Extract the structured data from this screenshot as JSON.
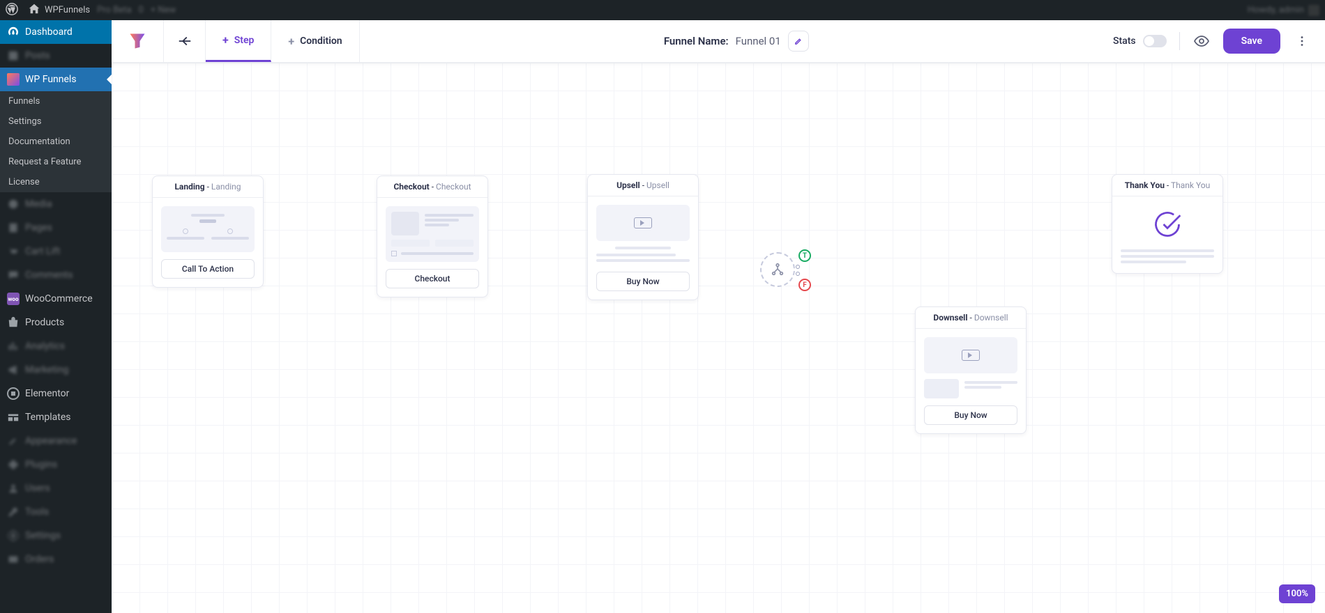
{
  "adminbar": {
    "site_name": "WPFunnels",
    "howdy": "Howdy, admin",
    "blur1": "Pro Beta",
    "blur2": "0",
    "blur3": "+ New"
  },
  "sidebar": {
    "dashboard": "Dashboard",
    "wp_funnels": "WP Funnels",
    "sub": {
      "funnels": "Funnels",
      "settings": "Settings",
      "documentation": "Documentation",
      "request": "Request a Feature",
      "license": "License"
    },
    "woocommerce": "WooCommerce",
    "products": "Products",
    "elementor": "Elementor",
    "templates": "Templates",
    "b": {
      "posts": "Posts",
      "media": "Media",
      "pages": "Pages",
      "cartlift": "Cart Lift",
      "comments": "Comments",
      "analytics": "Analytics",
      "marketing": "Marketing",
      "appearance": "Appearance",
      "plugins": "Plugins",
      "users": "Users",
      "tools": "Tools",
      "settings": "Settings",
      "other": "Orders"
    }
  },
  "topbar": {
    "step": "Step",
    "condition": "Condition",
    "funnel_label": "Funnel Name:",
    "funnel_value": "Funnel 01",
    "stats": "Stats",
    "save": "Save"
  },
  "nodes": {
    "landing": {
      "title": "Landing",
      "sub": "Landing",
      "cta": "Call To Action"
    },
    "checkout": {
      "title": "Checkout",
      "sub": "Checkout",
      "cta": "Checkout"
    },
    "upsell": {
      "title": "Upsell",
      "sub": "Upsell",
      "cta": "Buy Now"
    },
    "downsell": {
      "title": "Downsell",
      "sub": "Downsell",
      "cta": "Buy Now"
    },
    "thankyou": {
      "title": "Thank You",
      "sub": "Thank You"
    },
    "cond": {
      "t": "T",
      "f": "F"
    }
  },
  "zoom": "100%"
}
